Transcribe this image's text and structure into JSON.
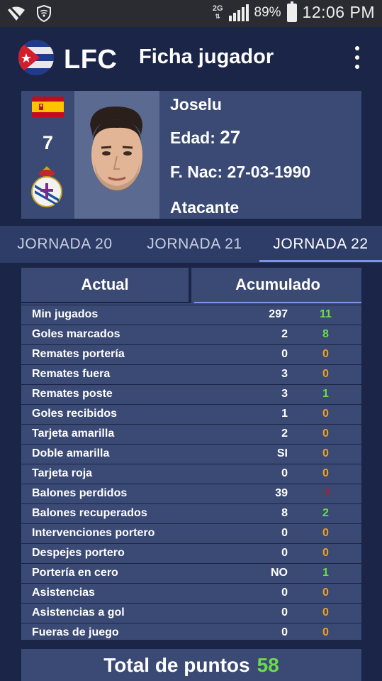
{
  "status_bar": {
    "network": "2G",
    "battery_percent": "89%",
    "time": "12:06 PM",
    "icons": [
      "wifi-off-icon",
      "vpn-shield-icon",
      "signal-icon",
      "battery-icon"
    ]
  },
  "header": {
    "app_name": "LFC",
    "title": "Ficha jugador",
    "icons": [
      "logo-cuba-flag-icon",
      "overflow-menu-icon"
    ]
  },
  "player": {
    "name": "Joselu",
    "number": "7",
    "age_label": "Edad:",
    "age": "27",
    "birth_label": "F. Nac:",
    "birth_date": "27-03-1990",
    "position": "Atacante",
    "icons": [
      "spain-flag-icon",
      "club-crest-icon",
      "player-photo"
    ]
  },
  "tabs": [
    {
      "label": "JORNADA 20"
    },
    {
      "label": "JORNADA 21"
    },
    {
      "label": "JORNADA 22",
      "active": true
    }
  ],
  "stats": {
    "segments": {
      "actual": "Actual",
      "acumulado": "Acumulado",
      "selected": "acumulado"
    },
    "rows": [
      {
        "label": "Min jugados",
        "value": "297",
        "delta": "11",
        "delta_color": "#6cdc4c"
      },
      {
        "label": "Goles marcados",
        "value": "2",
        "delta": "8",
        "delta_color": "#6cdc4c"
      },
      {
        "label": "Remates portería",
        "value": "0",
        "delta": "0",
        "delta_color": "#f0a020"
      },
      {
        "label": "Remates fuera",
        "value": "3",
        "delta": "0",
        "delta_color": "#f0a020"
      },
      {
        "label": "Remates poste",
        "value": "3",
        "delta": "1",
        "delta_color": "#6cdc4c"
      },
      {
        "label": "Goles recibidos",
        "value": "1",
        "delta": "0",
        "delta_color": "#f0a020"
      },
      {
        "label": "Tarjeta amarilla",
        "value": "2",
        "delta": "0",
        "delta_color": "#f0a020"
      },
      {
        "label": "Doble amarilla",
        "value": "SI",
        "delta": "0",
        "delta_color": "#f0a020"
      },
      {
        "label": "Tarjeta roja",
        "value": "0",
        "delta": "0",
        "delta_color": "#f0a020"
      },
      {
        "label": "Balones perdidos",
        "value": "39",
        "delta": "-7",
        "delta_color": "#c8102e"
      },
      {
        "label": "Balones recuperados",
        "value": "8",
        "delta": "2",
        "delta_color": "#6cdc4c"
      },
      {
        "label": "Intervenciones portero",
        "value": "0",
        "delta": "0",
        "delta_color": "#f0a020"
      },
      {
        "label": "Despejes portero",
        "value": "0",
        "delta": "0",
        "delta_color": "#f0a020"
      },
      {
        "label": "Portería en cero",
        "value": "NO",
        "delta": "1",
        "delta_color": "#6cdc4c"
      },
      {
        "label": "Asistencias",
        "value": "0",
        "delta": "0",
        "delta_color": "#f0a020"
      },
      {
        "label": "Asistencias a gol",
        "value": "0",
        "delta": "0",
        "delta_color": "#f0a020"
      },
      {
        "label": "Fueras de juego",
        "value": "0",
        "delta": "0",
        "delta_color": "#f0a020"
      }
    ]
  },
  "total": {
    "label": "Total de puntos",
    "value": "58"
  },
  "colors": {
    "background": "#1b2547",
    "panel": "#3a4a74",
    "accent": "#7c95e6",
    "positive": "#6cdc4c",
    "neutral": "#f0a020",
    "negative": "#c8102e"
  }
}
